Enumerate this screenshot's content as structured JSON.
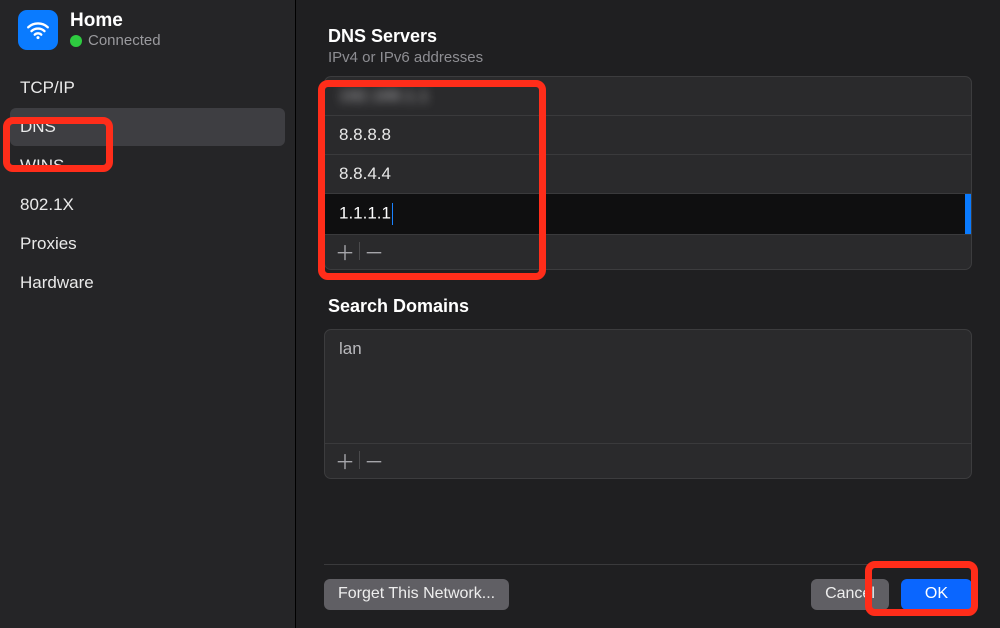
{
  "network": {
    "name": "Home",
    "status": "Connected"
  },
  "sidebar": {
    "items": [
      {
        "label": "TCP/IP"
      },
      {
        "label": "DNS"
      },
      {
        "label": "WINS"
      },
      {
        "label": "802.1X"
      },
      {
        "label": "Proxies"
      },
      {
        "label": "Hardware"
      }
    ],
    "selected_index": 1
  },
  "dns": {
    "title": "DNS Servers",
    "subtitle": "IPv4 or IPv6 addresses",
    "entries": [
      {
        "value": "192.168.1.1",
        "blurred": true
      },
      {
        "value": "8.8.8.8"
      },
      {
        "value": "8.8.4.4"
      },
      {
        "value": "1.1.1.1",
        "editing": true
      }
    ],
    "add_glyph": "＋",
    "remove_glyph": "－"
  },
  "search_domains": {
    "title": "Search Domains",
    "entries": [
      {
        "value": "lan"
      }
    ],
    "add_glyph": "＋",
    "remove_glyph": "－"
  },
  "footer": {
    "forget": "Forget This Network...",
    "cancel": "Cancel",
    "ok": "OK"
  }
}
